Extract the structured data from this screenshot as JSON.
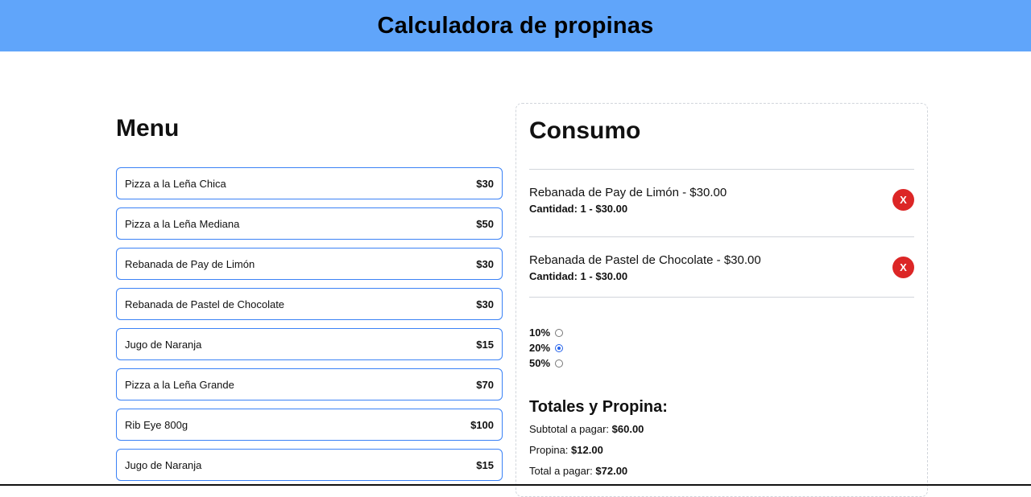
{
  "header": {
    "title": "Calculadora de propinas"
  },
  "menu": {
    "title": "Menu",
    "items": [
      {
        "name": "Pizza a la Leña Chica",
        "price": "$30"
      },
      {
        "name": "Pizza a la Leña Mediana",
        "price": "$50"
      },
      {
        "name": "Rebanada de Pay de Limón",
        "price": "$30"
      },
      {
        "name": "Rebanada de Pastel de Chocolate",
        "price": "$30"
      },
      {
        "name": "Jugo de Naranja",
        "price": "$15"
      },
      {
        "name": "Pizza a la Leña Grande",
        "price": "$70"
      },
      {
        "name": "Rib Eye 800g",
        "price": "$100"
      },
      {
        "name": "Jugo de Naranja",
        "price": "$15"
      }
    ]
  },
  "consumo": {
    "title": "Consumo",
    "orders": [
      {
        "title": "Rebanada de Pay de Limón - $30.00",
        "qty": "Cantidad: 1 - $30.00",
        "remove_label": "X"
      },
      {
        "title": "Rebanada de Pastel de Chocolate - $30.00",
        "qty": "Cantidad: 1 - $30.00",
        "remove_label": "X"
      }
    ],
    "tips": [
      {
        "label": "10%",
        "checked": false
      },
      {
        "label": "20%",
        "checked": true
      },
      {
        "label": "50%",
        "checked": false
      }
    ],
    "totals": {
      "title": "Totales y Propina:",
      "subtotal_label": "Subtotal a pagar:",
      "subtotal_value": "$60.00",
      "tip_label": "Propina:",
      "tip_value": "$12.00",
      "total_label": "Total a pagar:",
      "total_value": "$72.00"
    }
  },
  "colors": {
    "header_bg": "#60a5fa",
    "menu_border": "#3b82f6",
    "remove_button": "#dc2626",
    "radio_checked": "#2563eb"
  }
}
